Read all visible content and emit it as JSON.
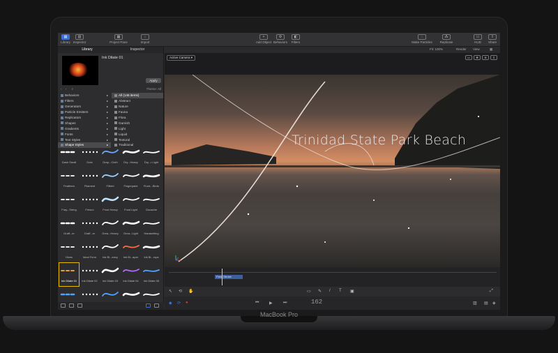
{
  "device": {
    "brand_label": "MacBook Pro"
  },
  "toolbar": {
    "left": [
      {
        "label": "Library",
        "icon": "library-icon",
        "active": true
      },
      {
        "label": "Inspector",
        "icon": "inspector-icon",
        "active": false
      }
    ],
    "project_pane": "Project Pane",
    "import": "Import",
    "center": [
      {
        "label": "Add Object",
        "icon": "plus-icon"
      },
      {
        "label": "Behaviors",
        "icon": "gear-icon"
      },
      {
        "label": "Filters",
        "icon": "filters-icon"
      }
    ],
    "right": [
      {
        "label": "Make Particles",
        "icon": "particles-icon"
      },
      {
        "label": "Replicate",
        "icon": "replicate-icon"
      },
      {
        "label": "HUD",
        "icon": "hud-icon"
      },
      {
        "label": "Share",
        "icon": "share-icon"
      }
    ]
  },
  "library": {
    "tabs": [
      "Library",
      "Inspector"
    ],
    "preview_title": "Ink Dilate 01",
    "apply_label": "Apply",
    "theme_label": "Theme: All",
    "categories": [
      {
        "label": "Behaviors",
        "selected": false
      },
      {
        "label": "Filters",
        "selected": false
      },
      {
        "label": "Generators",
        "selected": false
      },
      {
        "label": "Particle Emitters",
        "selected": false
      },
      {
        "label": "Replicators",
        "selected": false
      },
      {
        "label": "Shapes",
        "selected": false
      },
      {
        "label": "Gradients",
        "selected": false
      },
      {
        "label": "Fonts",
        "selected": false
      },
      {
        "label": "Text Styles",
        "selected": false
      },
      {
        "label": "Shape Styles",
        "selected": true
      }
    ],
    "subcategories": [
      {
        "label": "All (145 items)",
        "selected": true
      },
      {
        "label": "Abstract",
        "selected": false
      },
      {
        "label": "Nature",
        "selected": false
      },
      {
        "label": "Fauna",
        "selected": false
      },
      {
        "label": "Flora",
        "selected": false
      },
      {
        "label": "Garnish",
        "selected": false
      },
      {
        "label": "Light",
        "selected": false
      },
      {
        "label": "Liquid",
        "selected": false
      },
      {
        "label": "Textural",
        "selected": false
      },
      {
        "label": "Traditional",
        "selected": false
      }
    ],
    "styles": [
      {
        "label": "Dash Small",
        "color": "#ffffff"
      },
      {
        "label": "Dots",
        "color": "#ffffff"
      },
      {
        "label": "Drap...Cloth",
        "color": "#6aa9ff"
      },
      {
        "label": "Dry...Heavy",
        "color": "#ffffff"
      },
      {
        "label": "Dry...r Light",
        "color": "#ffffff"
      },
      {
        "label": "Feathers",
        "color": "#ffffff"
      },
      {
        "label": "Filament",
        "color": "#ffffff"
      },
      {
        "label": "Filbert",
        "color": "#9ad0ff"
      },
      {
        "label": "Fingerpaint",
        "color": "#ffffff"
      },
      {
        "label": "Flock...Birds",
        "color": "#ffffff"
      },
      {
        "label": "Fray...String",
        "color": "#ffffff"
      },
      {
        "label": "Fresco",
        "color": "#ffffff"
      },
      {
        "label": "Frost Heavy",
        "color": "#bfe3ff"
      },
      {
        "label": "Frost Light",
        "color": "#ffffff"
      },
      {
        "label": "Gouache",
        "color": "#ffffff"
      },
      {
        "label": "Graff...er",
        "color": "#ffffff"
      },
      {
        "label": "Graff...er",
        "color": "#ffffff"
      },
      {
        "label": "Grea...Heavy",
        "color": "#ffffff"
      },
      {
        "label": "Grea...Light",
        "color": "#ffffff"
      },
      {
        "label": "Handwriting",
        "color": "#ffffff"
      },
      {
        "label": "Hives",
        "color": "#ffffff"
      },
      {
        "label": "Ideal Form",
        "color": "#ffffff"
      },
      {
        "label": "Ink Bl...eavy",
        "color": "#ffffff"
      },
      {
        "label": "Ink Bl...aper",
        "color": "#ff6a3d"
      },
      {
        "label": "Ink Bl...rops",
        "color": "#ffffff"
      },
      {
        "label": "Ink Dilate 01",
        "color": "#ffb23a",
        "selected": true
      },
      {
        "label": "Ink Dilate 02",
        "color": "#ffffff"
      },
      {
        "label": "Ink Dilate 03",
        "color": "#ffffff"
      },
      {
        "label": "Ink Dilate 04",
        "color": "#b26bff"
      },
      {
        "label": "Ink Dilate 05",
        "color": "#4fa3ff"
      },
      {
        "label": "",
        "color": "#4fa3ff"
      },
      {
        "label": "",
        "color": "#ffffff"
      },
      {
        "label": "",
        "color": "#4fa3ff"
      },
      {
        "label": "",
        "color": "#ffffff"
      },
      {
        "label": "",
        "color": "#ffffff"
      }
    ]
  },
  "canvas": {
    "fit_label": "Fit: 100%",
    "render_label": "Render",
    "view_label": "View",
    "camera_label": "Active Camera",
    "title_text": "Trinidad State Park Beach",
    "timeline_clip": "Paint Stroke",
    "timecode": "162"
  }
}
